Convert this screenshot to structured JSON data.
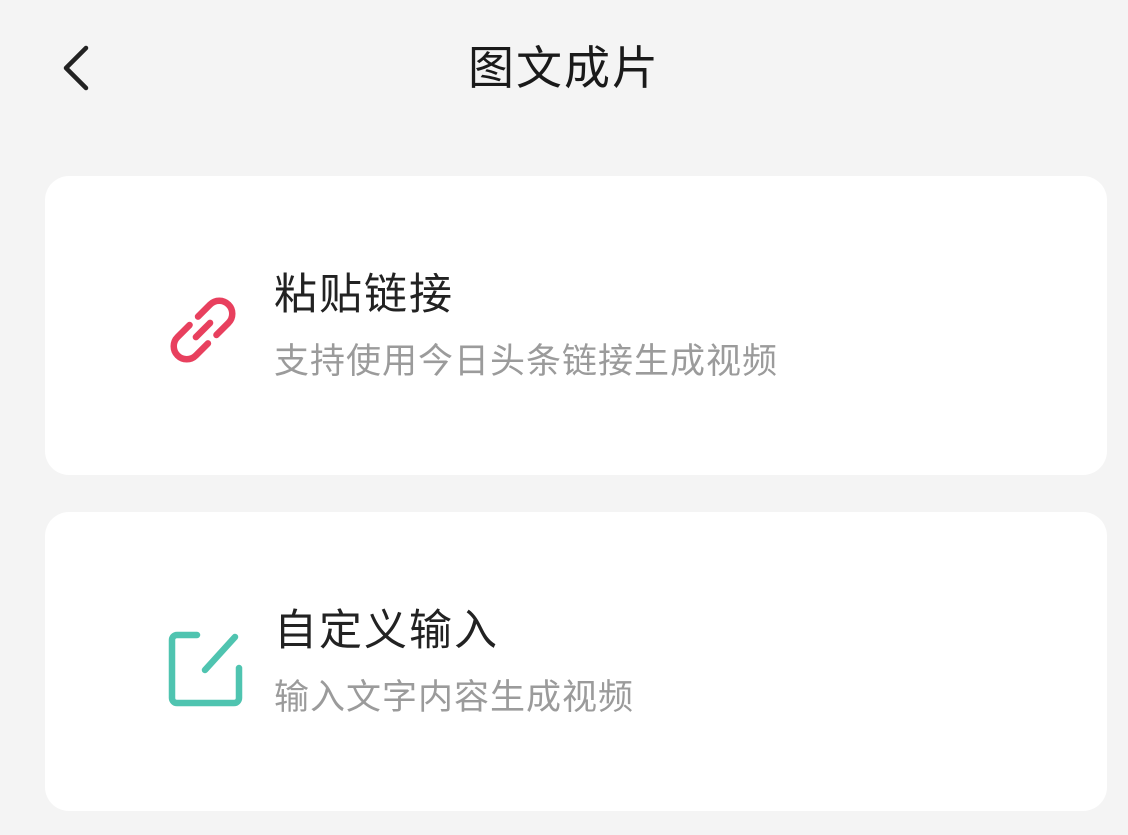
{
  "header": {
    "title": "图文成片",
    "back_icon": "chevron-left-icon"
  },
  "cards": [
    {
      "title": "粘贴链接",
      "subtitle": "支持使用今日头条链接生成视频",
      "icon": "link-icon",
      "icon_color": "#e8405e"
    },
    {
      "title": "自定义输入",
      "subtitle": "输入文字内容生成视频",
      "icon": "edit-icon",
      "icon_color": "#4fc4b0"
    }
  ],
  "colors": {
    "background": "#f4f4f4",
    "card": "#ffffff",
    "title_text": "#222222",
    "subtitle_text": "#9b9b9b"
  }
}
